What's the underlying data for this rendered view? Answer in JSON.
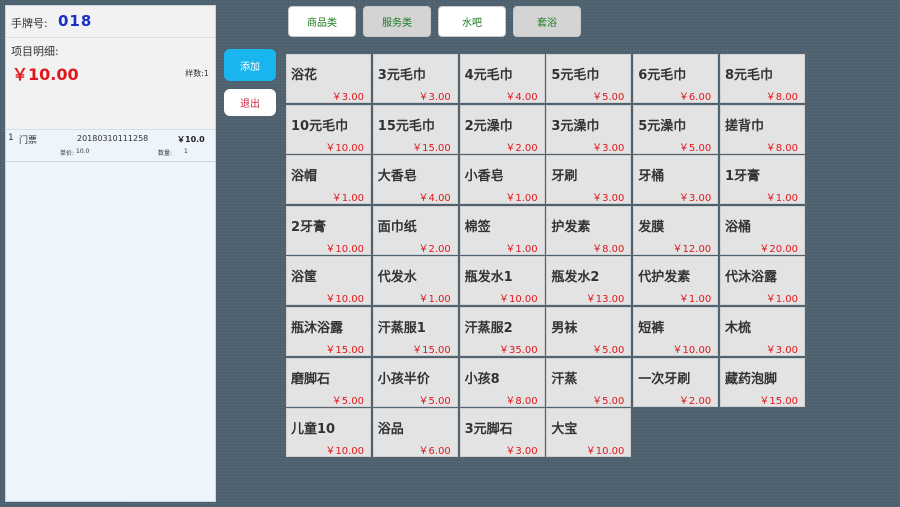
{
  "order": {
    "hand_label": "手牌号:",
    "hand_number": "018",
    "detail_label": "项目明细:",
    "total": "￥10.00",
    "count": "样数:1",
    "items": [
      {
        "index": "1",
        "name": "门票",
        "code": "20180310111258",
        "amount": "￥10.0",
        "price_label": "单价:",
        "price": "10.0",
        "qty_label": "数量:",
        "qty": "1"
      }
    ]
  },
  "actions": {
    "add": "添加",
    "exit": "退出"
  },
  "tabs": [
    {
      "label": "商品类",
      "active": true
    },
    {
      "label": "服务类",
      "active": false
    },
    {
      "label": "水吧",
      "active": true
    },
    {
      "label": "套浴",
      "active": false
    }
  ],
  "products": [
    {
      "name": "浴花",
      "price": "￥3.00"
    },
    {
      "name": "3元毛巾",
      "price": "￥3.00"
    },
    {
      "name": "4元毛巾",
      "price": "￥4.00"
    },
    {
      "name": "5元毛巾",
      "price": "￥5.00"
    },
    {
      "name": "6元毛巾",
      "price": "￥6.00"
    },
    {
      "name": "8元毛巾",
      "price": "￥8.00"
    },
    {
      "name": "10元毛巾",
      "price": "￥10.00"
    },
    {
      "name": "15元毛巾",
      "price": "￥15.00"
    },
    {
      "name": "2元澡巾",
      "price": "￥2.00"
    },
    {
      "name": "3元澡巾",
      "price": "￥3.00"
    },
    {
      "name": "5元澡巾",
      "price": "￥5.00"
    },
    {
      "name": "搓背巾",
      "price": "￥8.00"
    },
    {
      "name": "浴帽",
      "price": "￥1.00"
    },
    {
      "name": "大香皂",
      "price": "￥4.00"
    },
    {
      "name": "小香皂",
      "price": "￥1.00"
    },
    {
      "name": "牙刷",
      "price": "￥3.00"
    },
    {
      "name": "牙桶",
      "price": "￥3.00"
    },
    {
      "name": "1牙膏",
      "price": "￥1.00"
    },
    {
      "name": "2牙膏",
      "price": "￥10.00"
    },
    {
      "name": "面巾纸",
      "price": "￥2.00"
    },
    {
      "name": "棉签",
      "price": "￥1.00"
    },
    {
      "name": "护发素",
      "price": "￥8.00"
    },
    {
      "name": "发膜",
      "price": "￥12.00"
    },
    {
      "name": "浴桶",
      "price": "￥20.00"
    },
    {
      "name": "浴筐",
      "price": "￥10.00"
    },
    {
      "name": "代发水",
      "price": "￥1.00"
    },
    {
      "name": "瓶发水1",
      "price": "￥10.00"
    },
    {
      "name": "瓶发水2",
      "price": "￥13.00"
    },
    {
      "name": "代护发素",
      "price": "￥1.00"
    },
    {
      "name": "代沐浴露",
      "price": "￥1.00"
    },
    {
      "name": "瓶沐浴露",
      "price": "￥15.00"
    },
    {
      "name": "汗蒸服1",
      "price": "￥15.00"
    },
    {
      "name": "汗蒸服2",
      "price": "￥35.00"
    },
    {
      "name": "男袜",
      "price": "￥5.00"
    },
    {
      "name": "短裤",
      "price": "￥10.00"
    },
    {
      "name": "木梳",
      "price": "￥3.00"
    },
    {
      "name": "磨脚石",
      "price": "￥5.00"
    },
    {
      "name": "小孩半价",
      "price": "￥5.00"
    },
    {
      "name": "小孩8",
      "price": "￥8.00"
    },
    {
      "name": "汗蒸",
      "price": "￥5.00"
    },
    {
      "name": "一次牙刷",
      "price": "￥2.00"
    },
    {
      "name": "藏药泡脚",
      "price": "￥15.00"
    },
    {
      "name": "儿童10",
      "price": "￥10.00"
    },
    {
      "name": "浴品",
      "price": "￥6.00"
    },
    {
      "name": "3元脚石",
      "price": "￥3.00"
    },
    {
      "name": "大宝",
      "price": "￥10.00"
    }
  ]
}
